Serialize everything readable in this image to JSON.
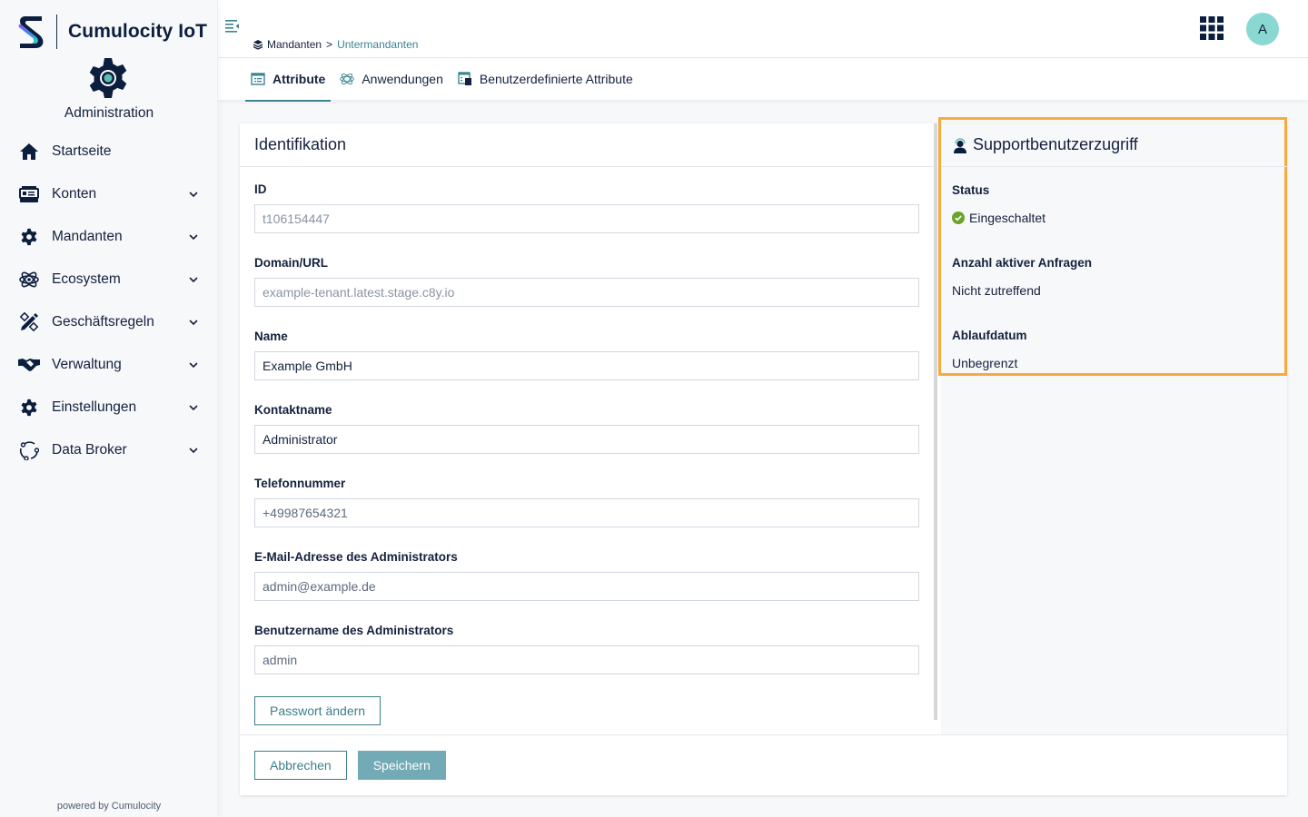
{
  "brand": {
    "name": "Cumulocity IoT",
    "app_name": "Administration",
    "powered_by": "powered by Cumulocity"
  },
  "sidebar": {
    "items": [
      {
        "label": "Startseite",
        "icon": "home-icon",
        "expandable": false
      },
      {
        "label": "Konten",
        "icon": "accounts-icon",
        "expandable": true
      },
      {
        "label": "Mandanten",
        "icon": "gear-icon",
        "expandable": true
      },
      {
        "label": "Ecosystem",
        "icon": "atom-icon",
        "expandable": true
      },
      {
        "label": "Geschäftsregeln",
        "icon": "rules-icon",
        "expandable": true
      },
      {
        "label": "Verwaltung",
        "icon": "handshake-icon",
        "expandable": true
      },
      {
        "label": "Einstellungen",
        "icon": "gear-icon",
        "expandable": true
      },
      {
        "label": "Data Broker",
        "icon": "data-broker-icon",
        "expandable": true
      }
    ]
  },
  "header": {
    "breadcrumb": {
      "root": "Mandanten",
      "separator": ">",
      "current": "Untermandanten"
    },
    "avatar_initial": "A"
  },
  "tabs": [
    {
      "label": "Attribute",
      "icon": "list-icon",
      "active": true
    },
    {
      "label": "Anwendungen",
      "icon": "atom-icon",
      "active": false
    },
    {
      "label": "Benutzerdefinierte Attribute",
      "icon": "custom-properties-icon",
      "active": false
    }
  ],
  "identification": {
    "title": "Identifikation",
    "fields": [
      {
        "label": "ID",
        "value": "t106154447",
        "readonly": true
      },
      {
        "label": "Domain/URL",
        "value": "example-tenant.latest.stage.c8y.io",
        "readonly": true
      },
      {
        "label": "Name",
        "value": "Example GmbH",
        "readonly": false
      },
      {
        "label": "Kontaktname",
        "value": "Administrator",
        "readonly": false
      },
      {
        "label": "Telefonnummer",
        "value": "+49987654321",
        "readonly": false
      },
      {
        "label": "E-Mail-Adresse des Administrators",
        "value": "admin@example.de",
        "readonly": false
      },
      {
        "label": "Benutzername des Administrators",
        "value": "admin",
        "readonly": false
      }
    ],
    "change_password_label": "Passwort ändern"
  },
  "support": {
    "title": "Supportbenutzerzugriff",
    "status_label": "Status",
    "status_value": "Eingeschaltet",
    "requests_label": "Anzahl aktiver Anfragen",
    "requests_value": "Nicht zutreffend",
    "expiry_label": "Ablaufdatum",
    "expiry_value": "Unbegrenzt",
    "highlight_color": "#f7ab3e",
    "status_color": "#6aa428"
  },
  "footer": {
    "cancel_label": "Abbrechen",
    "save_label": "Speichern"
  },
  "colors": {
    "accent": "#3b8591",
    "primary_button": "#72aab5",
    "avatar": "#89d8d1"
  }
}
